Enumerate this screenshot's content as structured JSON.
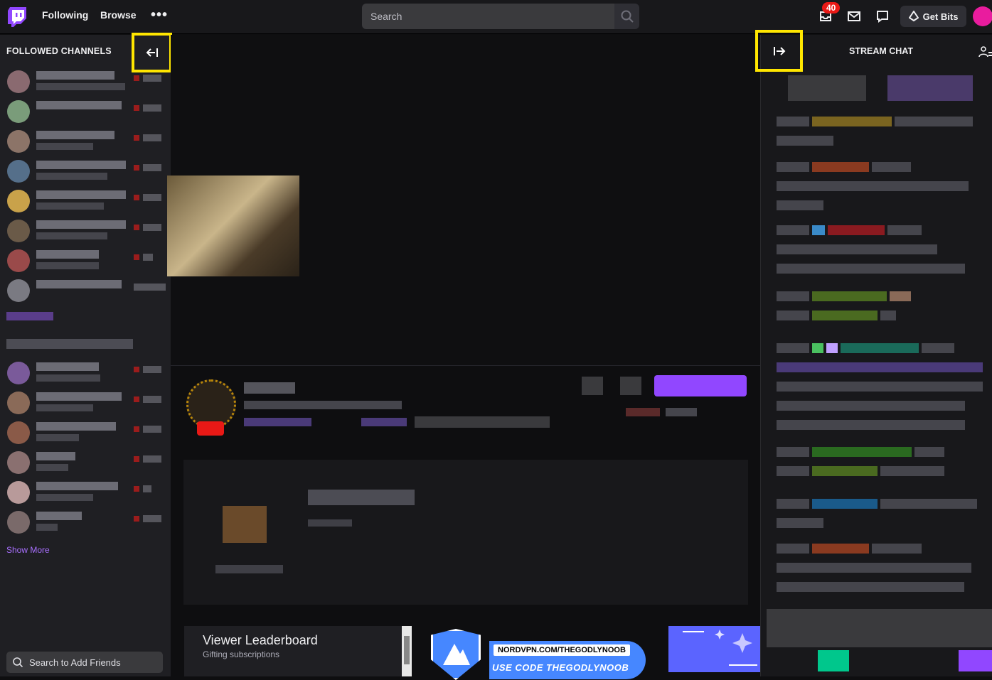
{
  "topnav": {
    "following": "Following",
    "browse": "Browse",
    "more": "•••",
    "search_placeholder": "Search",
    "notifications_count": "40",
    "get_bits": "Get Bits"
  },
  "sidebar": {
    "title": "FOLLOWED CHANNELS",
    "show_more": "Show More",
    "friends_search": "Search to Add Friends"
  },
  "panels": {
    "leaderboard_title": "Viewer Leaderboard",
    "leaderboard_sub": "Gifting subscriptions",
    "nord_url": "NORDVPN.COM/THEGODLYNOOB",
    "nord_code_prefix": "USE CODE",
    "nord_code": "THEGODLYNOOB"
  },
  "chat": {
    "title": "STREAM CHAT"
  },
  "colors": {
    "accent": "#9147ff",
    "highlight": "#ffe600",
    "live": "#e91916"
  }
}
